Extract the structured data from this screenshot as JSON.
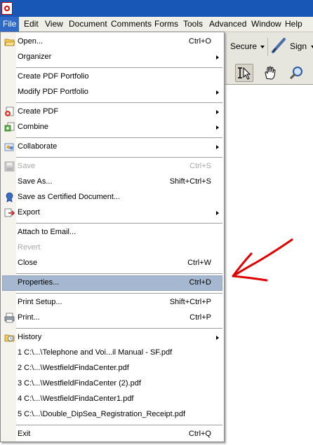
{
  "menubar": {
    "items": [
      "File",
      "Edit",
      "View",
      "Document",
      "Comments",
      "Forms",
      "Tools",
      "Advanced",
      "Window",
      "Help"
    ],
    "active": "File"
  },
  "toolbar": {
    "secure_label": "Secure",
    "sign_label": "Sign"
  },
  "file_menu": {
    "items": [
      {
        "label": "Open...",
        "shortcut": "Ctrl+O",
        "icon": "open-folder-icon"
      },
      {
        "label": "Organizer",
        "shortcut": "",
        "submenu": true
      },
      {
        "label": "Create PDF Portfolio",
        "shortcut": ""
      },
      {
        "label": "Modify PDF Portfolio",
        "shortcut": "",
        "submenu": true
      },
      {
        "label": "Create PDF",
        "shortcut": "",
        "submenu": true,
        "icon": "create-pdf-icon"
      },
      {
        "label": "Combine",
        "shortcut": "",
        "submenu": true,
        "icon": "combine-icon"
      },
      {
        "label": "Collaborate",
        "shortcut": "",
        "submenu": true,
        "icon": "collaborate-icon"
      },
      {
        "label": "Save",
        "shortcut": "Ctrl+S",
        "disabled": true,
        "icon": "save-icon"
      },
      {
        "label": "Save As...",
        "shortcut": "Shift+Ctrl+S"
      },
      {
        "label": "Save as Certified Document...",
        "shortcut": "",
        "icon": "certified-ribbon-icon"
      },
      {
        "label": "Export",
        "shortcut": "",
        "submenu": true,
        "icon": "export-icon"
      },
      {
        "label": "Attach to Email...",
        "shortcut": ""
      },
      {
        "label": "Revert",
        "shortcut": "",
        "disabled": true
      },
      {
        "label": "Close",
        "shortcut": "Ctrl+W"
      },
      {
        "label": "Properties...",
        "shortcut": "Ctrl+D",
        "highlighted": true
      },
      {
        "label": "Print Setup...",
        "shortcut": "Shift+Ctrl+P"
      },
      {
        "label": "Print...",
        "shortcut": "Ctrl+P",
        "icon": "printer-icon"
      },
      {
        "label": "History",
        "shortcut": "",
        "submenu": true,
        "icon": "history-icon"
      },
      {
        "label": "1 C:\\...\\Telephone and Voi...il Manual - SF.pdf",
        "shortcut": ""
      },
      {
        "label": "2 C:\\...\\WestfieldFindaCenter.pdf",
        "shortcut": ""
      },
      {
        "label": "3 C:\\...\\WestfieldFindaCenter (2).pdf",
        "shortcut": ""
      },
      {
        "label": "4 C:\\...\\WestfieldFindaCenter1.pdf",
        "shortcut": ""
      },
      {
        "label": "5 C:\\...\\Double_DipSea_Registration_Receipt.pdf",
        "shortcut": ""
      },
      {
        "label": "Exit",
        "shortcut": "Ctrl+Q"
      }
    ]
  },
  "annotation": {
    "arrow_color": "#e00000"
  }
}
